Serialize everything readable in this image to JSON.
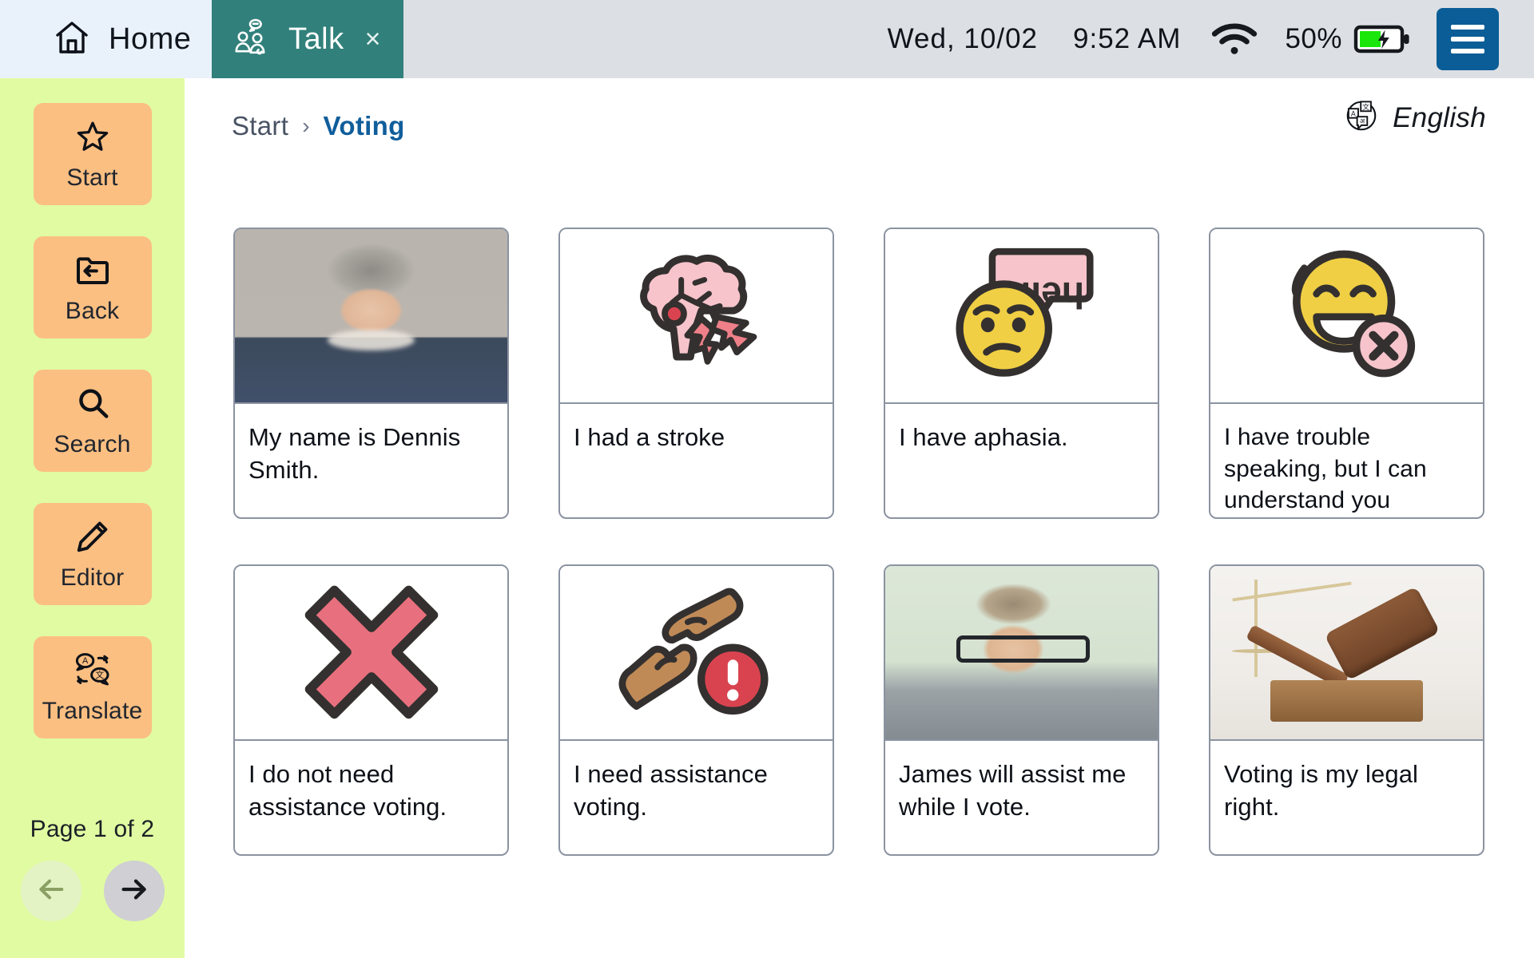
{
  "topbar": {
    "tabs": [
      {
        "label": "Home",
        "icon": "home-icon",
        "active": false
      },
      {
        "label": "Talk",
        "icon": "people-talking-icon",
        "active": true,
        "close": "×"
      }
    ],
    "status": {
      "date": "Wed, 10/02",
      "time": "9:52 AM",
      "wifi_icon": "wifi-icon",
      "battery_percent": "50%",
      "battery_icon": "battery-charging-icon",
      "menu_icon": "hamburger-menu-icon"
    },
    "colors": {
      "talk_tab": "#31807b",
      "home_tab": "#e9f2fb",
      "bar": "#dcdfe4",
      "menu_button": "#0a5d96"
    }
  },
  "sidebar": {
    "background": "#e1fba2",
    "button_color": "#fbbf82",
    "items": [
      {
        "label": "Start",
        "icon": "star-icon"
      },
      {
        "label": "Back",
        "icon": "folder-back-arrow-icon"
      },
      {
        "label": "Search",
        "icon": "magnifier-icon"
      },
      {
        "label": "Editor",
        "icon": "pencil-icon"
      },
      {
        "label": "Translate",
        "icon": "translate-speech-bubbles-icon"
      }
    ],
    "pager": {
      "label": "Page 1 of 2",
      "prev_icon": "arrow-left-icon",
      "next_icon": "arrow-right-icon",
      "prev_enabled": false,
      "next_enabled": true
    }
  },
  "breadcrumb": {
    "root": "Start",
    "separator": "›",
    "current": "Voting"
  },
  "language": {
    "label": "English",
    "icon": "translate-globe-icon"
  },
  "grid": {
    "cards": [
      {
        "text": "My name is Dennis Smith.",
        "media": "photo-dennis",
        "media_type": "photo"
      },
      {
        "text": "I had a stroke",
        "media": "brain-stroke-icon",
        "media_type": "icon"
      },
      {
        "text": "I have aphasia.",
        "media": "confused-face-speech-bubble-icon",
        "media_type": "icon"
      },
      {
        "text": "I have trouble speaking, but I can understand you",
        "media": "sweating-smile-no-speech-icon",
        "media_type": "icon"
      },
      {
        "text": "I do not need assistance voting.",
        "media": "red-x-icon",
        "media_type": "icon"
      },
      {
        "text": "I need assistance voting.",
        "media": "helping-hands-alert-icon",
        "media_type": "icon"
      },
      {
        "text": "James will assist me while I vote.",
        "media": "photo-james",
        "media_type": "photo"
      },
      {
        "text": "Voting is my legal right.",
        "media": "photo-gavel",
        "media_type": "photo"
      }
    ],
    "card_border_color": "#8b93a1"
  }
}
